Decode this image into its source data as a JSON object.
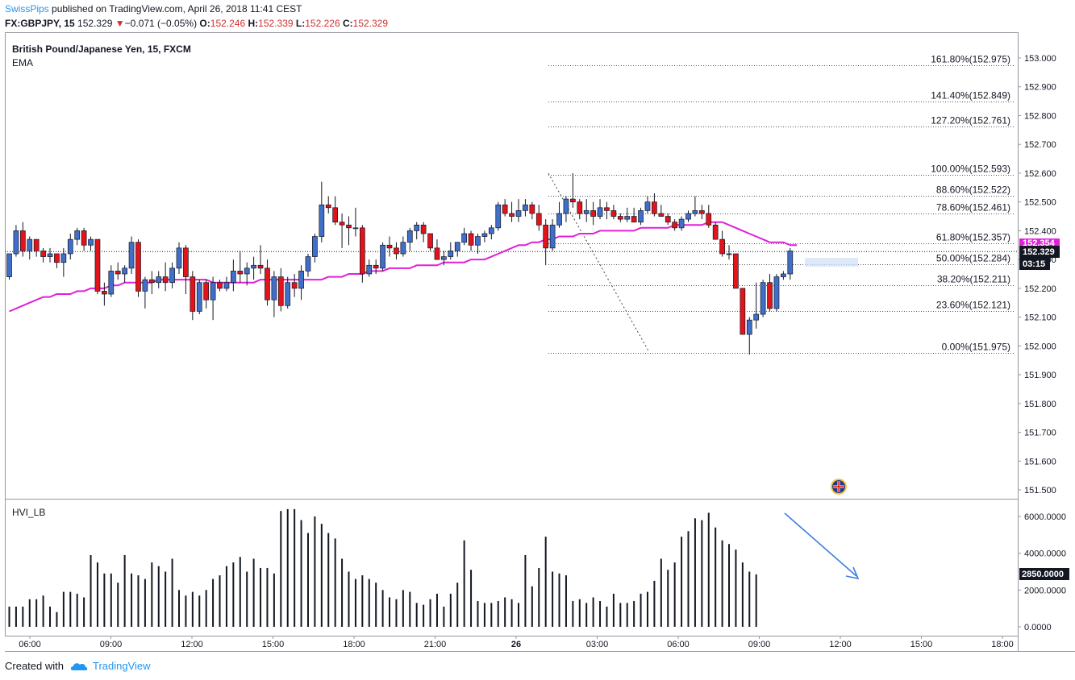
{
  "header": {
    "publisher": "SwissPips",
    "published_text": "published on TradingView.com, April 26, 2018 11:41 CEST",
    "symbol_line": "FX:GBPJPY, 15",
    "last_price": "152.329",
    "change": "−0.071 (−0.05%)",
    "open_label": "O:",
    "open_value": "152.246",
    "high_label": "H:",
    "high_value": "152.339",
    "low_label": "L:",
    "low_value": "152.226",
    "close_label": "C:",
    "close_value": "152.329"
  },
  "main_pane": {
    "title": "British Pound/Japanese Yen, 15, FXCM",
    "indicator": "EMA",
    "price_badge": "152.329",
    "countdown_badge": "03:15",
    "ema_badge": "152.354"
  },
  "volume_pane": {
    "title": "HVI_LB",
    "last_badge": "2850.0000"
  },
  "footer": {
    "created_with": "Created with",
    "brand": "TradingView"
  },
  "colors": {
    "up": "#3f6fc9",
    "down": "#e3131b",
    "ema": "#e020d8",
    "badge_dark": "#131722",
    "badge_ema": "#e020d8",
    "arrow": "#3f7de0"
  },
  "chart_data": [
    {
      "type": "candlestick",
      "title": "British Pound/Japanese Yen, 15, FXCM",
      "y_axis": {
        "ticks": [
          "153.000",
          "152.900",
          "152.800",
          "152.700",
          "152.600",
          "152.500",
          "152.400",
          "152.300",
          "152.200",
          "152.100",
          "152.000",
          "151.900",
          "151.800",
          "151.700",
          "151.600",
          "151.500"
        ],
        "ylim": [
          151.47,
          153.04
        ]
      },
      "x_axis": {
        "ticks": [
          "06:00",
          "09:00",
          "12:00",
          "15:00",
          "18:00",
          "21:00",
          "26",
          "03:00",
          "06:00",
          "09:00",
          "12:00",
          "15:00",
          "18:00"
        ]
      },
      "fibonacci": [
        {
          "label": "161.80%(152.975)",
          "price": 152.975
        },
        {
          "label": "141.40%(152.849)",
          "price": 152.849
        },
        {
          "label": "127.20%(152.761)",
          "price": 152.761
        },
        {
          "label": "100.00%(152.593)",
          "price": 152.593
        },
        {
          "label": "88.60%(152.522)",
          "price": 152.522
        },
        {
          "label": "78.60%(152.461)",
          "price": 152.461
        },
        {
          "label": "61.80%(152.357)",
          "price": 152.357
        },
        {
          "label": "50.00%(152.284)",
          "price": 152.284
        },
        {
          "label": "38.20%(152.211)",
          "price": 152.211
        },
        {
          "label": "23.60%(152.121)",
          "price": 152.121
        },
        {
          "label": "0.00%(151.975)",
          "price": 151.975
        }
      ],
      "candles": [
        [
          152.24,
          152.32,
          152.23,
          152.32
        ],
        [
          152.32,
          152.42,
          152.31,
          152.4
        ],
        [
          152.4,
          152.43,
          152.31,
          152.33
        ],
        [
          152.33,
          152.38,
          152.3,
          152.37
        ],
        [
          152.37,
          152.37,
          152.31,
          152.33
        ],
        [
          152.33,
          152.34,
          152.29,
          152.31
        ],
        [
          152.31,
          152.34,
          152.29,
          152.32
        ],
        [
          152.32,
          152.32,
          152.27,
          152.29
        ],
        [
          152.29,
          152.34,
          152.24,
          152.32
        ],
        [
          152.32,
          152.39,
          152.3,
          152.37
        ],
        [
          152.37,
          152.41,
          152.35,
          152.4
        ],
        [
          152.4,
          152.41,
          152.33,
          152.35
        ],
        [
          152.35,
          152.38,
          152.33,
          152.37
        ],
        [
          152.37,
          152.37,
          152.18,
          152.19
        ],
        [
          152.19,
          152.22,
          152.14,
          152.18
        ],
        [
          152.18,
          152.28,
          152.17,
          152.26
        ],
        [
          152.26,
          152.29,
          152.23,
          152.25
        ],
        [
          152.25,
          152.28,
          152.22,
          152.27
        ],
        [
          152.27,
          152.38,
          152.25,
          152.36
        ],
        [
          152.36,
          152.37,
          152.17,
          152.19
        ],
        [
          152.19,
          152.24,
          152.13,
          152.23
        ],
        [
          152.23,
          152.26,
          152.18,
          152.22
        ],
        [
          152.22,
          152.26,
          152.2,
          152.24
        ],
        [
          152.24,
          152.29,
          152.19,
          152.22
        ],
        [
          152.22,
          152.29,
          152.2,
          152.27
        ],
        [
          152.27,
          152.36,
          152.25,
          152.34
        ],
        [
          152.34,
          152.35,
          152.18,
          152.24
        ],
        [
          152.24,
          152.26,
          152.09,
          152.12
        ],
        [
          152.12,
          152.23,
          152.11,
          152.22
        ],
        [
          152.22,
          152.23,
          152.13,
          152.16
        ],
        [
          152.16,
          152.24,
          152.09,
          152.22
        ],
        [
          152.22,
          152.23,
          152.19,
          152.2
        ],
        [
          152.2,
          152.24,
          152.19,
          152.22
        ],
        [
          152.22,
          152.3,
          152.19,
          152.26
        ],
        [
          152.26,
          152.33,
          152.22,
          152.25
        ],
        [
          152.25,
          152.29,
          152.21,
          152.27
        ],
        [
          152.27,
          152.31,
          152.23,
          152.28
        ],
        [
          152.28,
          152.35,
          152.25,
          152.27
        ],
        [
          152.27,
          152.3,
          152.14,
          152.16
        ],
        [
          152.16,
          152.26,
          152.1,
          152.24
        ],
        [
          152.24,
          152.27,
          152.12,
          152.14
        ],
        [
          152.14,
          152.24,
          152.13,
          152.22
        ],
        [
          152.22,
          152.25,
          152.17,
          152.2
        ],
        [
          152.2,
          152.28,
          152.16,
          152.26
        ],
        [
          152.26,
          152.32,
          152.24,
          152.31
        ],
        [
          152.31,
          152.39,
          152.29,
          152.38
        ],
        [
          152.38,
          152.57,
          152.36,
          152.49
        ],
        [
          152.49,
          152.52,
          152.46,
          152.48
        ],
        [
          152.48,
          152.52,
          152.42,
          152.43
        ],
        [
          152.43,
          152.46,
          152.34,
          152.42
        ],
        [
          152.42,
          152.45,
          152.35,
          152.41
        ],
        [
          152.41,
          152.48,
          152.38,
          152.41
        ],
        [
          152.41,
          152.42,
          152.22,
          152.25
        ],
        [
          152.25,
          152.3,
          152.24,
          152.28
        ],
        [
          152.28,
          152.3,
          152.25,
          152.27
        ],
        [
          152.27,
          152.36,
          152.26,
          152.35
        ],
        [
          152.35,
          152.38,
          152.31,
          152.34
        ],
        [
          152.34,
          152.36,
          152.3,
          152.32
        ],
        [
          152.32,
          152.38,
          152.31,
          152.36
        ],
        [
          152.36,
          152.41,
          152.33,
          152.4
        ],
        [
          152.4,
          152.43,
          152.37,
          152.42
        ],
        [
          152.42,
          152.43,
          152.36,
          152.39
        ],
        [
          152.39,
          152.39,
          152.33,
          152.34
        ],
        [
          152.34,
          152.37,
          152.3,
          152.3
        ],
        [
          152.3,
          152.33,
          152.28,
          152.31
        ],
        [
          152.31,
          152.36,
          152.3,
          152.33
        ],
        [
          152.33,
          152.36,
          152.31,
          152.36
        ],
        [
          152.36,
          152.41,
          152.35,
          152.39
        ],
        [
          152.39,
          152.4,
          152.33,
          152.35
        ],
        [
          152.35,
          152.39,
          152.32,
          152.38
        ],
        [
          152.38,
          152.4,
          152.36,
          152.39
        ],
        [
          152.39,
          152.42,
          152.37,
          152.41
        ],
        [
          152.41,
          152.5,
          152.4,
          152.49
        ],
        [
          152.49,
          152.51,
          152.45,
          152.46
        ],
        [
          152.46,
          152.5,
          152.43,
          152.45
        ],
        [
          152.45,
          152.51,
          152.43,
          152.47
        ],
        [
          152.47,
          152.51,
          152.45,
          152.49
        ],
        [
          152.49,
          152.5,
          152.44,
          152.46
        ],
        [
          152.46,
          152.49,
          152.4,
          152.42
        ],
        [
          152.42,
          152.44,
          152.28,
          152.34
        ],
        [
          152.34,
          152.44,
          152.33,
          152.42
        ],
        [
          152.42,
          152.5,
          152.41,
          152.46
        ],
        [
          152.46,
          152.52,
          152.43,
          152.51
        ],
        [
          152.51,
          152.6,
          152.48,
          152.5
        ],
        [
          152.5,
          152.51,
          152.44,
          152.46
        ],
        [
          152.46,
          152.51,
          152.43,
          152.47
        ],
        [
          152.47,
          152.5,
          152.42,
          152.45
        ],
        [
          152.45,
          152.51,
          152.44,
          152.48
        ],
        [
          152.48,
          152.5,
          152.44,
          152.47
        ],
        [
          152.47,
          152.49,
          152.44,
          152.45
        ],
        [
          152.45,
          152.46,
          152.43,
          152.44
        ],
        [
          152.44,
          152.48,
          152.43,
          152.45
        ],
        [
          152.45,
          152.48,
          152.43,
          152.43
        ],
        [
          152.43,
          152.48,
          152.42,
          152.47
        ],
        [
          152.47,
          152.52,
          152.46,
          152.5
        ],
        [
          152.5,
          152.53,
          152.45,
          152.46
        ],
        [
          152.46,
          152.49,
          152.45,
          152.45
        ],
        [
          152.45,
          152.46,
          152.42,
          152.43
        ],
        [
          152.43,
          152.44,
          152.4,
          152.41
        ],
        [
          152.41,
          152.45,
          152.4,
          152.44
        ],
        [
          152.44,
          152.47,
          152.43,
          152.46
        ],
        [
          152.46,
          152.52,
          152.45,
          152.47
        ],
        [
          152.47,
          152.49,
          152.44,
          152.46
        ],
        [
          152.46,
          152.49,
          152.41,
          152.42
        ],
        [
          152.42,
          152.43,
          152.37,
          152.37
        ],
        [
          152.37,
          152.4,
          152.31,
          152.32
        ],
        [
          152.32,
          152.35,
          152.3,
          152.32
        ],
        [
          152.32,
          152.32,
          152.2,
          152.2
        ],
        [
          152.2,
          152.2,
          152.05,
          152.04
        ],
        [
          152.04,
          152.1,
          151.97,
          152.09
        ],
        [
          152.09,
          152.22,
          152.06,
          152.11
        ],
        [
          152.11,
          152.23,
          152.1,
          152.22
        ],
        [
          152.22,
          152.25,
          152.12,
          152.13
        ],
        [
          152.13,
          152.25,
          152.12,
          152.24
        ],
        [
          152.24,
          152.26,
          152.23,
          152.25
        ],
        [
          152.25,
          152.34,
          152.23,
          152.33
        ]
      ],
      "ema": [
        152.12,
        152.13,
        152.14,
        152.15,
        152.16,
        152.17,
        152.17,
        152.18,
        152.18,
        152.18,
        152.19,
        152.19,
        152.2,
        152.2,
        152.2,
        152.21,
        152.21,
        152.22,
        152.22,
        152.22,
        152.22,
        152.22,
        152.23,
        152.23,
        152.23,
        152.23,
        152.23,
        152.23,
        152.23,
        152.23,
        152.22,
        152.22,
        152.22,
        152.22,
        152.22,
        152.22,
        152.22,
        152.23,
        152.23,
        152.23,
        152.23,
        152.23,
        152.23,
        152.23,
        152.23,
        152.23,
        152.23,
        152.24,
        152.24,
        152.24,
        152.25,
        152.25,
        152.25,
        152.26,
        152.26,
        152.26,
        152.27,
        152.27,
        152.27,
        152.27,
        152.28,
        152.28,
        152.28,
        152.28,
        152.29,
        152.29,
        152.29,
        152.29,
        152.3,
        152.3,
        152.3,
        152.31,
        152.32,
        152.33,
        152.34,
        152.35,
        152.35,
        152.36,
        152.36,
        152.37,
        152.37,
        152.38,
        152.38,
        152.38,
        152.39,
        152.39,
        152.39,
        152.4,
        152.4,
        152.4,
        152.4,
        152.4,
        152.4,
        152.41,
        152.41,
        152.41,
        152.41,
        152.41,
        152.42,
        152.42,
        152.42,
        152.42,
        152.42,
        152.43,
        152.43,
        152.43,
        152.42,
        152.41,
        152.4,
        152.39,
        152.38,
        152.37,
        152.36,
        152.36,
        152.36,
        152.35,
        152.35
      ]
    },
    {
      "type": "bar",
      "title": "HVI_LB",
      "y_axis": {
        "ticks": [
          "6000.0000",
          "4000.0000",
          "2000.0000",
          "0.0000"
        ],
        "ylim": [
          0,
          6800
        ]
      },
      "values": [
        1100,
        1100,
        1100,
        1500,
        1500,
        1700,
        1100,
        800,
        1900,
        1900,
        1800,
        1600,
        3900,
        3500,
        2900,
        2900,
        2400,
        3900,
        2900,
        2800,
        2600,
        3500,
        3300,
        3000,
        3700,
        2000,
        1700,
        1900,
        1700,
        2000,
        2600,
        2800,
        3300,
        3500,
        3800,
        3000,
        3700,
        3200,
        3200,
        2900,
        6300,
        6400,
        6400,
        5800,
        5100,
        6000,
        5600,
        5100,
        4800,
        3700,
        3000,
        2600,
        2800,
        2600,
        2400,
        2000,
        1600,
        1500,
        2000,
        1900,
        1300,
        1200,
        1500,
        1800,
        1100,
        1800,
        2400,
        4700,
        3100,
        1400,
        1300,
        1300,
        1400,
        1600,
        1500,
        1300,
        3900,
        2200,
        3200,
        4900,
        3000,
        2900,
        2800,
        1400,
        1500,
        1300,
        1600,
        1400,
        1100,
        1800,
        1300,
        1300,
        1400,
        1800,
        1900,
        2500,
        3700,
        3100,
        3500,
        4900,
        5200,
        5900,
        5800,
        6200,
        5400,
        4700,
        4500,
        4200,
        3500,
        3000,
        2850
      ]
    }
  ]
}
